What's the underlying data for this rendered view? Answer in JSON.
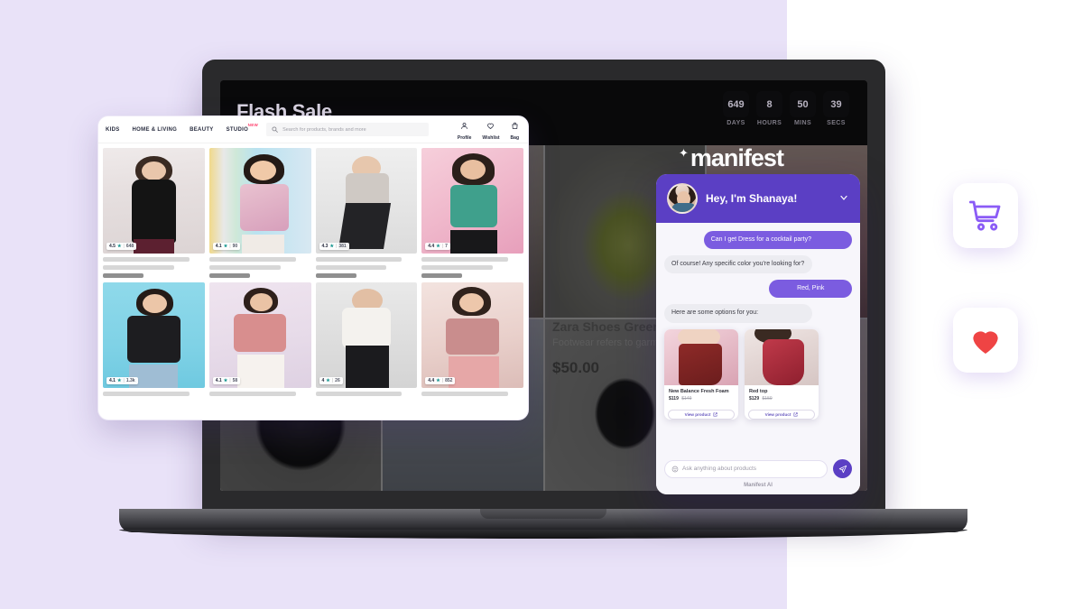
{
  "background": {
    "left_color": "#e9e2f8",
    "right_color": "#ffffff"
  },
  "site": {
    "flash_sale_title": "Flash Sale",
    "countdown": [
      {
        "value": "649",
        "label": "DAYS"
      },
      {
        "value": "8",
        "label": "HOURS"
      },
      {
        "value": "50",
        "label": "MINS"
      },
      {
        "value": "39",
        "label": "SECS"
      }
    ],
    "featured_product": {
      "name": "Zara Shoes Green",
      "description": "Footwear refers to garm...",
      "price": "$50.00"
    }
  },
  "grid_card": {
    "nav_links": [
      "KIDS",
      "HOME & LIVING",
      "BEAUTY",
      "STUDIO"
    ],
    "studio_badge": "NEW",
    "search_placeholder": "Search for products, brands and more",
    "actions": [
      {
        "icon": "profile-icon",
        "label": "Profile"
      },
      {
        "icon": "wishlist-icon",
        "label": "Wishlist"
      },
      {
        "icon": "bag-icon",
        "label": "Bag"
      }
    ],
    "products": [
      {
        "rating": "4.5",
        "count": "648"
      },
      {
        "rating": "4.1",
        "count": "90"
      },
      {
        "rating": "4.3",
        "count": "381"
      },
      {
        "rating": "4.4",
        "count": "7"
      },
      {
        "rating": "4.1",
        "count": "1.3k"
      },
      {
        "rating": "4.1",
        "count": "58"
      },
      {
        "rating": "4",
        "count": "26"
      },
      {
        "rating": "4.4",
        "count": "852"
      }
    ]
  },
  "logo": {
    "text": "manifest",
    "sparkle": "✦"
  },
  "chat": {
    "header_title": "Hey, I'm Shanaya!",
    "collapse_icon": "chevron-down-icon",
    "messages": [
      {
        "from": "user",
        "text": "Can I get Dress for a cocktail party?"
      },
      {
        "from": "bot",
        "text": "Of course! Any specific color you're looking for?"
      },
      {
        "from": "user",
        "text": "Red, Pink",
        "short": true
      },
      {
        "from": "bot",
        "text": "Here are some options for you:"
      }
    ],
    "product_cards": [
      {
        "name": "New Balance Fresh Foam",
        "price": "$119",
        "old_price": "$149",
        "cta": "View product"
      },
      {
        "name": "Red top",
        "price": "$129",
        "old_price": "$159",
        "cta": "View product"
      }
    ],
    "input_placeholder": "Ask anything about products",
    "send_icon": "send-icon",
    "emoji_icon": "emoji-icon",
    "brand_footer": "Manifest AI",
    "header_color": "#5b3fc4",
    "user_bubble_color": "#7b5ce0"
  },
  "floating_icons": [
    {
      "name": "cart-icon",
      "color": "#8b5cf6"
    },
    {
      "name": "heart-icon",
      "color": "#ef4444"
    }
  ]
}
